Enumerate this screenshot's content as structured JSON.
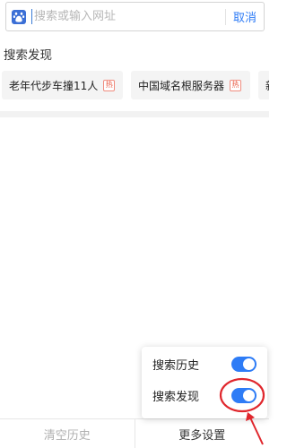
{
  "search": {
    "placeholder": "搜索或输入网址",
    "cancel_label": "取消"
  },
  "discover": {
    "title": "搜索发现",
    "chips": [
      {
        "label": "老年代步车撞11人",
        "badge": "热"
      },
      {
        "label": "中国域名根服务器",
        "badge": "热"
      },
      {
        "label": "新",
        "badge": ""
      }
    ]
  },
  "popup": {
    "items": [
      {
        "label": "搜索历史",
        "enabled": true
      },
      {
        "label": "搜索发现",
        "enabled": true
      }
    ]
  },
  "bottom": {
    "clear_label": "清空历史",
    "settings_label": "更多设置"
  },
  "colors": {
    "accent": "#2e7cf6",
    "annotation_red": "#e0272d",
    "hot_badge": "#e8563f"
  },
  "icons": {
    "search_logo": "baidu-paw-icon"
  }
}
